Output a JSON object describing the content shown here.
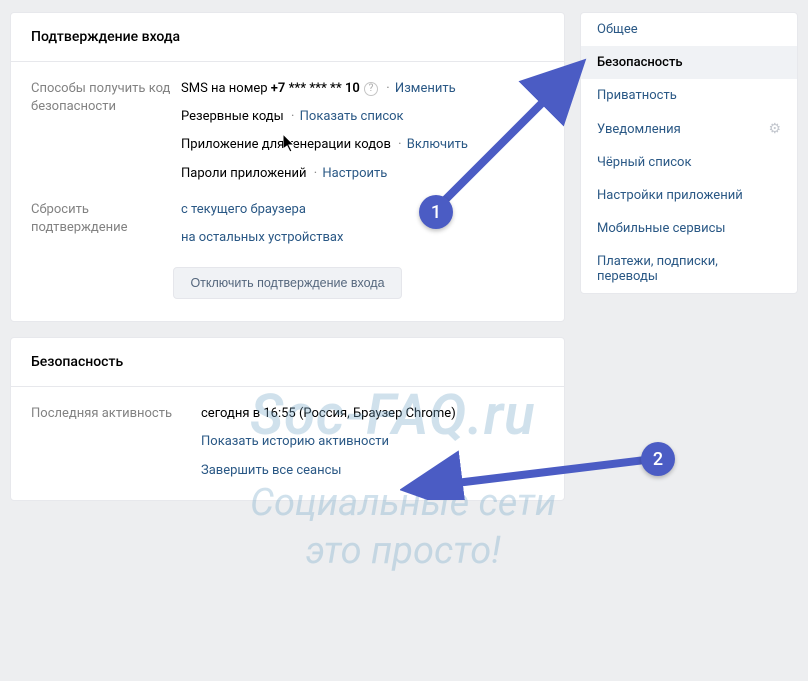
{
  "confirmation_panel": {
    "title": "Подтверждение входа",
    "methods_label": "Способы получить код безопасности",
    "sms_prefix": "SMS на номер ",
    "sms_number": "+7 *** *** ** 10",
    "change": "Изменить",
    "backup_codes": "Резервные коды",
    "show_list": "Показать список",
    "codegen_app": "Приложение для генерации кодов",
    "enable": "Включить",
    "app_passwords": "Пароли приложений",
    "configure": "Настроить",
    "reset_label": "Сбросить подтверждение",
    "reset_current": "с текущего браузера",
    "reset_others": "на остальных устройствах",
    "disable_button": "Отключить подтверждение входа"
  },
  "security_panel": {
    "title": "Безопасность",
    "last_activity_label": "Последняя активность",
    "last_activity_value": "сегодня в 16:55 (Россия, Браузер Chrome)",
    "show_history": "Показать историю активности",
    "end_sessions": "Завершить все сеансы"
  },
  "sidebar": {
    "items": [
      {
        "label": "Общее"
      },
      {
        "label": "Безопасность",
        "active": true
      },
      {
        "label": "Приватность"
      },
      {
        "label": "Уведомления",
        "gear": true
      },
      {
        "label": "Чёрный список"
      },
      {
        "label": "Настройки приложений"
      },
      {
        "label": "Мобильные сервисы"
      },
      {
        "label": "Платежи, подписки, переводы"
      }
    ]
  },
  "watermark": {
    "title": "Soc-FAQ.ru",
    "subtitle1": "Социальные сети",
    "subtitle2": "это просто!"
  },
  "annotations": {
    "badge1": "1",
    "badge2": "2"
  },
  "glyphs": {
    "question": "?",
    "gear": "⚙"
  }
}
